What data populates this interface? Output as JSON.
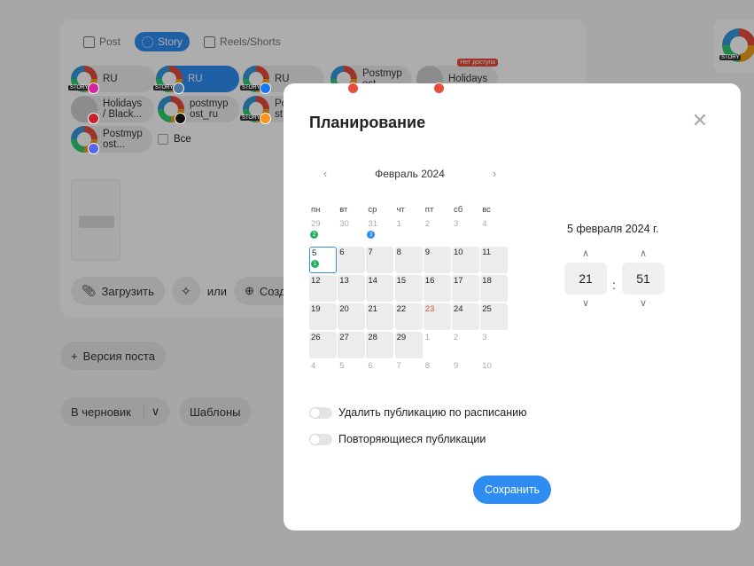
{
  "colors": {
    "accent": "#2f8cf0",
    "badge_green": "#27ae60",
    "badge_blue": "#2f8cf0",
    "weekend_red": "#e74c3c"
  },
  "editor": {
    "tabs": [
      {
        "label": "Post",
        "icon": "post-icon"
      },
      {
        "label": "Story",
        "icon": "story-icon"
      },
      {
        "label": "Reels/Shorts",
        "icon": "reels-icon"
      }
    ],
    "accounts": [
      {
        "label": "RU",
        "network": "instagram"
      },
      {
        "label": "RU",
        "network": "vk"
      },
      {
        "label": "RU",
        "network": "facebook"
      },
      {
        "label": "Postmyp ost",
        "network": "youtube"
      },
      {
        "label": "Holidays",
        "network": "youtube",
        "badge": "Нет доступа"
      },
      {
        "label": "Holidays / Black...",
        "network": "pinterest"
      },
      {
        "label": "postmyp ost_ru",
        "network": "x"
      },
      {
        "label": "Po st",
        "network": "ok"
      },
      {
        "label": "Postmyp ost...",
        "network": "discord"
      }
    ],
    "all_label": "Все",
    "upload_label": "Загрузить",
    "or_label": "или",
    "create_label": "Созда",
    "version_label": "Версия поста",
    "draft_label": "В черновик",
    "templates_label": "Шаблоны"
  },
  "modal": {
    "title": "Планирование",
    "calendar": {
      "month_label": "Февраль 2024",
      "weekdays": [
        "пн",
        "вт",
        "ср",
        "чт",
        "пт",
        "сб",
        "вс"
      ],
      "weeks": [
        [
          {
            "d": "29",
            "o": true,
            "b": "2",
            "bc": "green"
          },
          {
            "d": "30",
            "o": true
          },
          {
            "d": "31",
            "o": true,
            "b": "1",
            "bc": "blue"
          },
          {
            "d": "1",
            "o": true
          },
          {
            "d": "2",
            "o": true
          },
          {
            "d": "3",
            "o": true
          },
          {
            "d": "4",
            "o": true
          }
        ],
        [
          {
            "d": "5",
            "today": true,
            "b": "1",
            "bc": "green"
          },
          {
            "d": "6"
          },
          {
            "d": "7"
          },
          {
            "d": "8"
          },
          {
            "d": "9"
          },
          {
            "d": "10"
          },
          {
            "d": "11"
          }
        ],
        [
          {
            "d": "12"
          },
          {
            "d": "13"
          },
          {
            "d": "14"
          },
          {
            "d": "15"
          },
          {
            "d": "16"
          },
          {
            "d": "17"
          },
          {
            "d": "18"
          }
        ],
        [
          {
            "d": "19"
          },
          {
            "d": "20"
          },
          {
            "d": "21"
          },
          {
            "d": "22"
          },
          {
            "d": "23",
            "red": true
          },
          {
            "d": "24"
          },
          {
            "d": "25"
          }
        ],
        [
          {
            "d": "26"
          },
          {
            "d": "27"
          },
          {
            "d": "28"
          },
          {
            "d": "29"
          },
          {
            "d": "1",
            "o": true
          },
          {
            "d": "2",
            "o": true
          },
          {
            "d": "3",
            "o": true
          }
        ],
        [
          {
            "d": "4",
            "o": true
          },
          {
            "d": "5",
            "o": true
          },
          {
            "d": "6",
            "o": true
          },
          {
            "d": "7",
            "o": true
          },
          {
            "d": "8",
            "o": true
          },
          {
            "d": "9",
            "o": true
          },
          {
            "d": "10",
            "o": true
          }
        ]
      ]
    },
    "selected_date": "5 февраля 2024 г.",
    "hours": "21",
    "minutes": "51",
    "time_separator": ":",
    "toggles": [
      {
        "label": "Удалить публикацию по расписанию",
        "on": false
      },
      {
        "label": "Повторяющиеся публикации",
        "on": false
      }
    ],
    "save_label": "Сохранить"
  }
}
